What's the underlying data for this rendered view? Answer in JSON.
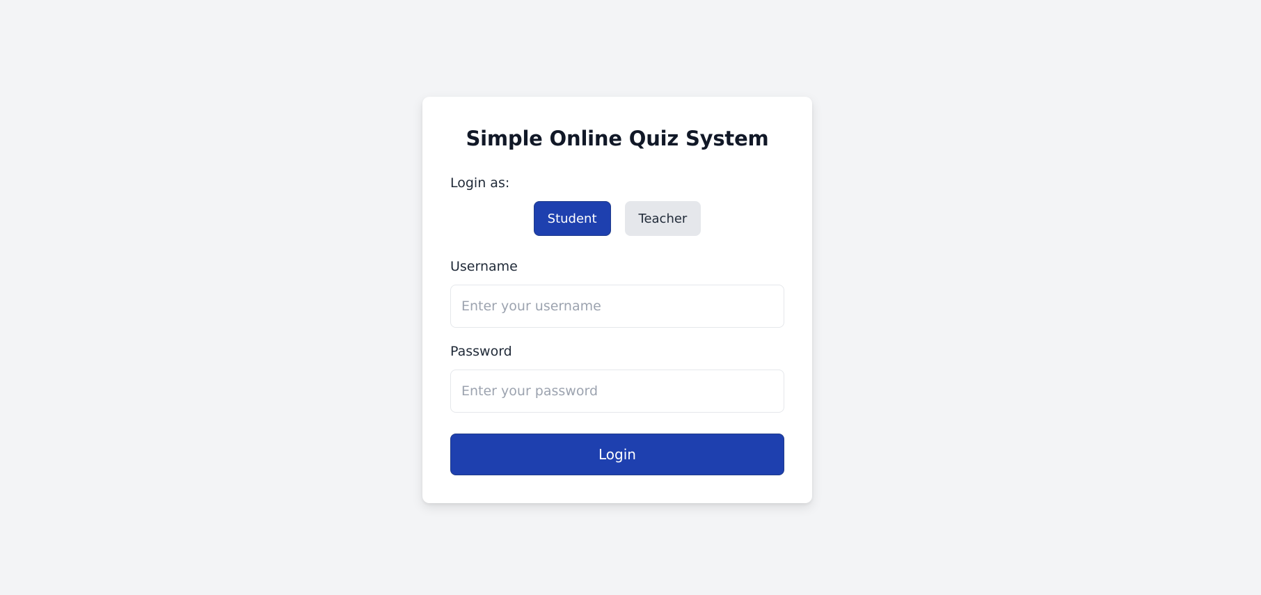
{
  "login": {
    "title": "Simple Online Quiz System",
    "role_label": "Login as:",
    "roles": [
      {
        "label": "Student",
        "active": true
      },
      {
        "label": "Teacher",
        "active": false
      }
    ],
    "username": {
      "label": "Username",
      "placeholder": "Enter your username",
      "value": ""
    },
    "password": {
      "label": "Password",
      "placeholder": "Enter your password",
      "value": ""
    },
    "submit_label": "Login"
  },
  "colors": {
    "background": "#f3f4f6",
    "card": "#ffffff",
    "primary": "#1e40af",
    "inactive_button": "#e5e7eb",
    "text": "#111827",
    "placeholder": "#9ca3af"
  }
}
